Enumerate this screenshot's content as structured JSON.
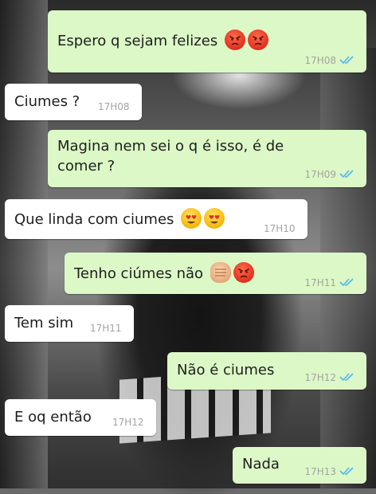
{
  "colors": {
    "outgoing_bubble": "#dcf8c6",
    "incoming_bubble": "#ffffff",
    "read_ticks": "#4fb6ec",
    "timestamp": "#a3a3a3"
  },
  "messages": [
    {
      "text": "Espero q sejam felizes",
      "time": "17H08",
      "direction": "outgoing",
      "emojis": [
        "angry-face",
        "angry-face"
      ],
      "status": "read"
    },
    {
      "text": "Ciumes ?",
      "time": "17H08",
      "direction": "incoming"
    },
    {
      "text": "Magina nem sei o q é isso, é de comer ?",
      "time": "17H09",
      "direction": "outgoing",
      "status": "read"
    },
    {
      "text": "Que linda com ciumes",
      "time": "17H10",
      "direction": "incoming",
      "emojis": [
        "heart-eyes-face",
        "heart-eyes-face"
      ]
    },
    {
      "text": "Tenho ciúmes não",
      "time": "17H11",
      "direction": "outgoing",
      "emojis": [
        "fist",
        "angry-face"
      ],
      "status": "read"
    },
    {
      "text": "Tem sim",
      "time": "17H11",
      "direction": "incoming"
    },
    {
      "text": "Não é ciumes",
      "time": "17H12",
      "direction": "outgoing",
      "status": "read"
    },
    {
      "text": "E oq então",
      "time": "17H12",
      "direction": "incoming"
    },
    {
      "text": "Nada",
      "time": "17H13",
      "direction": "outgoing",
      "status": "read"
    }
  ]
}
